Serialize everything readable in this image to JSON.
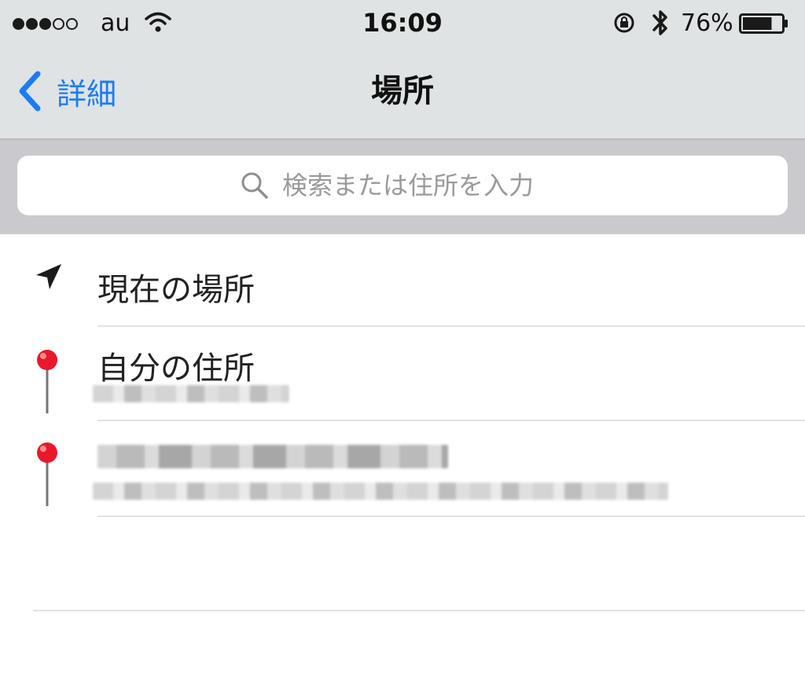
{
  "status_bar": {
    "carrier": "au",
    "time": "16:09",
    "battery_percent": "76%",
    "battery_level": 0.76,
    "signal_bars_filled": 3,
    "signal_bars_total": 5
  },
  "nav": {
    "back_label": "詳細",
    "title": "場所"
  },
  "search": {
    "placeholder": "検索または住所を入力"
  },
  "list": {
    "items": [
      {
        "title": "現在の場所",
        "icon": "location-arrow-icon"
      },
      {
        "title": "自分の住所",
        "icon": "red-pin-icon"
      },
      {
        "title": "",
        "icon": "red-pin-icon"
      }
    ]
  },
  "colors": {
    "accent": "#1a7cf5",
    "pin": "#e8192c",
    "header_bg": "#dfe3e4",
    "search_bar_bg": "#c9c9ce"
  }
}
